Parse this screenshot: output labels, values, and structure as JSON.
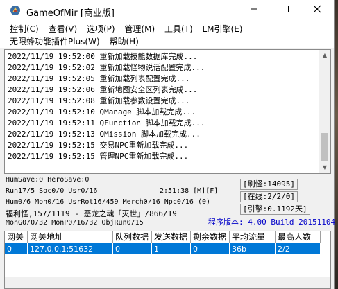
{
  "window": {
    "title": "GameOfMir [商业版]",
    "controls": {
      "minimize": "—",
      "maximize": "☐",
      "close": "✕"
    }
  },
  "menu": {
    "row1": [
      "控制(C)",
      "查看(V)",
      "选项(P)",
      "管理(M)",
      "工具(T)",
      "LM引擎(E)"
    ],
    "row2": [
      "无限蜂功能插件Plus(W)",
      "帮助(H)"
    ]
  },
  "log": [
    "2022/11/19 19:52:00 重新加载技能数据库完成...",
    "2022/11/19 19:52:02 重新加载怪物说话配置完成...",
    "2022/11/19 19:52:05 重新加载列表配置完成...",
    "2022/11/19 19:52:06 重新地图安全区列表完成...",
    "2022/11/19 19:52:08 重新加载参数设置完成...",
    "2022/11/19 19:52:10 QManage 脚本加载完成...",
    "2022/11/19 19:52:11 QFunction 脚本加载完成...",
    "2022/11/19 19:52:13 QMission 脚本加载完成...",
    "2022/11/19 19:52:15 交易NPC重新加载完成...",
    "2022/11/19 19:52:15 管理NPC重新加载完成..."
  ],
  "status": {
    "line1": "HumSave:0 HeroSave:0",
    "line2": "Run17/5 Soc0/0 Usr0/16",
    "clock": "2:51:38 [M][F]",
    "line3": "Hum0/6 Mon0/16 UsrRot16/459 Merch0/16 Npc0/16 (0)",
    "line4": "福利怪,157/1119 - 恶龙之魂「灭世」/866/19",
    "line5": "MonG0/0/32 MonP0/16/32 ObjRun0/15",
    "panel_refresh": "[刷怪:14095]",
    "panel_online": "[在线:2/2/0]",
    "panel_engine": "[引擎:0.1192天]",
    "version": "程序版本: 4.00 Build 20151104"
  },
  "table": {
    "headers": [
      "网关",
      "网关地址",
      "队列数据",
      "发送数据",
      "剩余数据",
      "平均流量",
      "最高人数"
    ],
    "rows": [
      [
        "0",
        "127.0.0.1:51632",
        "0",
        "1",
        "0",
        "36b",
        "2/2"
      ]
    ]
  },
  "colors": {
    "selection": "#0078d7",
    "version_text": "#0000c8"
  }
}
